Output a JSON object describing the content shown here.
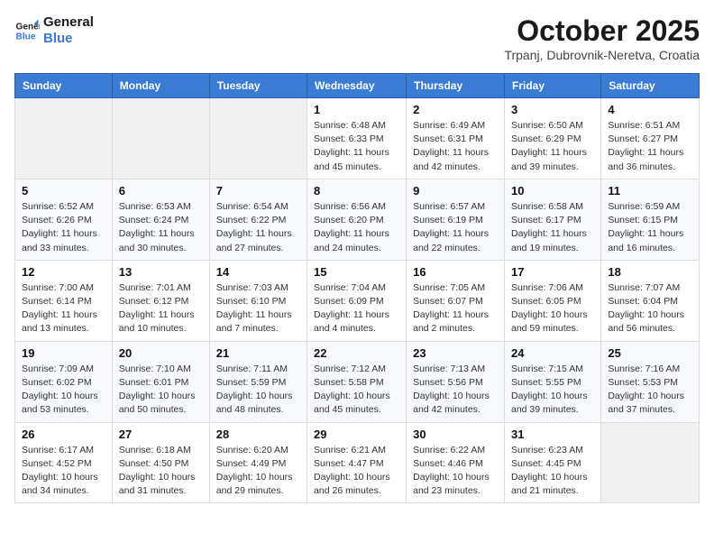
{
  "header": {
    "logo": {
      "line1": "General",
      "line2": "Blue"
    },
    "title": "October 2025",
    "subtitle": "Trpanj, Dubrovnik-Neretva, Croatia"
  },
  "days_of_week": [
    "Sunday",
    "Monday",
    "Tuesday",
    "Wednesday",
    "Thursday",
    "Friday",
    "Saturday"
  ],
  "weeks": [
    [
      {
        "day": "",
        "info": ""
      },
      {
        "day": "",
        "info": ""
      },
      {
        "day": "",
        "info": ""
      },
      {
        "day": "1",
        "info": "Sunrise: 6:48 AM\nSunset: 6:33 PM\nDaylight: 11 hours and 45 minutes."
      },
      {
        "day": "2",
        "info": "Sunrise: 6:49 AM\nSunset: 6:31 PM\nDaylight: 11 hours and 42 minutes."
      },
      {
        "day": "3",
        "info": "Sunrise: 6:50 AM\nSunset: 6:29 PM\nDaylight: 11 hours and 39 minutes."
      },
      {
        "day": "4",
        "info": "Sunrise: 6:51 AM\nSunset: 6:27 PM\nDaylight: 11 hours and 36 minutes."
      }
    ],
    [
      {
        "day": "5",
        "info": "Sunrise: 6:52 AM\nSunset: 6:26 PM\nDaylight: 11 hours and 33 minutes."
      },
      {
        "day": "6",
        "info": "Sunrise: 6:53 AM\nSunset: 6:24 PM\nDaylight: 11 hours and 30 minutes."
      },
      {
        "day": "7",
        "info": "Sunrise: 6:54 AM\nSunset: 6:22 PM\nDaylight: 11 hours and 27 minutes."
      },
      {
        "day": "8",
        "info": "Sunrise: 6:56 AM\nSunset: 6:20 PM\nDaylight: 11 hours and 24 minutes."
      },
      {
        "day": "9",
        "info": "Sunrise: 6:57 AM\nSunset: 6:19 PM\nDaylight: 11 hours and 22 minutes."
      },
      {
        "day": "10",
        "info": "Sunrise: 6:58 AM\nSunset: 6:17 PM\nDaylight: 11 hours and 19 minutes."
      },
      {
        "day": "11",
        "info": "Sunrise: 6:59 AM\nSunset: 6:15 PM\nDaylight: 11 hours and 16 minutes."
      }
    ],
    [
      {
        "day": "12",
        "info": "Sunrise: 7:00 AM\nSunset: 6:14 PM\nDaylight: 11 hours and 13 minutes."
      },
      {
        "day": "13",
        "info": "Sunrise: 7:01 AM\nSunset: 6:12 PM\nDaylight: 11 hours and 10 minutes."
      },
      {
        "day": "14",
        "info": "Sunrise: 7:03 AM\nSunset: 6:10 PM\nDaylight: 11 hours and 7 minutes."
      },
      {
        "day": "15",
        "info": "Sunrise: 7:04 AM\nSunset: 6:09 PM\nDaylight: 11 hours and 4 minutes."
      },
      {
        "day": "16",
        "info": "Sunrise: 7:05 AM\nSunset: 6:07 PM\nDaylight: 11 hours and 2 minutes."
      },
      {
        "day": "17",
        "info": "Sunrise: 7:06 AM\nSunset: 6:05 PM\nDaylight: 10 hours and 59 minutes."
      },
      {
        "day": "18",
        "info": "Sunrise: 7:07 AM\nSunset: 6:04 PM\nDaylight: 10 hours and 56 minutes."
      }
    ],
    [
      {
        "day": "19",
        "info": "Sunrise: 7:09 AM\nSunset: 6:02 PM\nDaylight: 10 hours and 53 minutes."
      },
      {
        "day": "20",
        "info": "Sunrise: 7:10 AM\nSunset: 6:01 PM\nDaylight: 10 hours and 50 minutes."
      },
      {
        "day": "21",
        "info": "Sunrise: 7:11 AM\nSunset: 5:59 PM\nDaylight: 10 hours and 48 minutes."
      },
      {
        "day": "22",
        "info": "Sunrise: 7:12 AM\nSunset: 5:58 PM\nDaylight: 10 hours and 45 minutes."
      },
      {
        "day": "23",
        "info": "Sunrise: 7:13 AM\nSunset: 5:56 PM\nDaylight: 10 hours and 42 minutes."
      },
      {
        "day": "24",
        "info": "Sunrise: 7:15 AM\nSunset: 5:55 PM\nDaylight: 10 hours and 39 minutes."
      },
      {
        "day": "25",
        "info": "Sunrise: 7:16 AM\nSunset: 5:53 PM\nDaylight: 10 hours and 37 minutes."
      }
    ],
    [
      {
        "day": "26",
        "info": "Sunrise: 6:17 AM\nSunset: 4:52 PM\nDaylight: 10 hours and 34 minutes."
      },
      {
        "day": "27",
        "info": "Sunrise: 6:18 AM\nSunset: 4:50 PM\nDaylight: 10 hours and 31 minutes."
      },
      {
        "day": "28",
        "info": "Sunrise: 6:20 AM\nSunset: 4:49 PM\nDaylight: 10 hours and 29 minutes."
      },
      {
        "day": "29",
        "info": "Sunrise: 6:21 AM\nSunset: 4:47 PM\nDaylight: 10 hours and 26 minutes."
      },
      {
        "day": "30",
        "info": "Sunrise: 6:22 AM\nSunset: 4:46 PM\nDaylight: 10 hours and 23 minutes."
      },
      {
        "day": "31",
        "info": "Sunrise: 6:23 AM\nSunset: 4:45 PM\nDaylight: 10 hours and 21 minutes."
      },
      {
        "day": "",
        "info": ""
      }
    ]
  ]
}
